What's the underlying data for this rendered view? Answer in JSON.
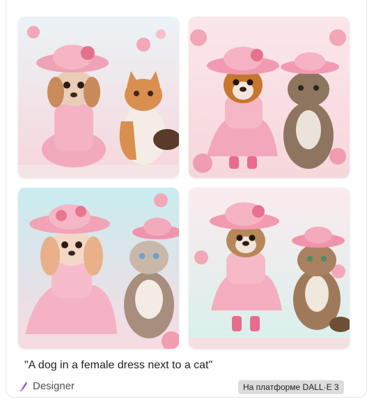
{
  "card": {
    "caption": "\"A dog in a female dress next to a cat\"",
    "designer_label": "Designer",
    "platform_label": "На платформе DALL·E 3"
  },
  "images": [
    {
      "subject": "dog in pink dress with cat"
    },
    {
      "subject": "dog in pink dress with cat"
    },
    {
      "subject": "dog in pink dress with cat"
    },
    {
      "subject": "dog in pink dress with cat"
    }
  ],
  "colors": {
    "designer_icon": "#9b59d0",
    "badge_bg": "#dcdcdc"
  }
}
